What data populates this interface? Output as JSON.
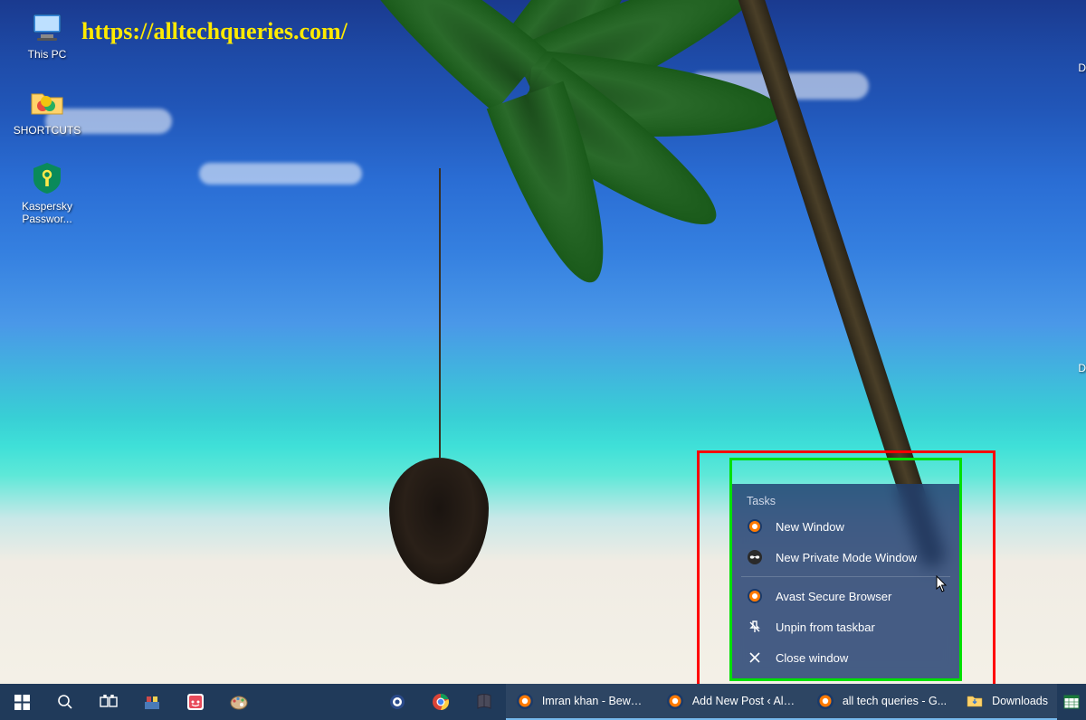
{
  "watermark_url": "https://alltechqueries.com/",
  "desktop_icons": {
    "thispc": {
      "label": "This PC"
    },
    "shortcuts": {
      "label": "SHORTCUTS"
    },
    "kaspersky": {
      "label": "Kaspersky Passwor..."
    }
  },
  "right_edge": {
    "label1": "D",
    "label2": "D"
  },
  "jumplist": {
    "section_header": "Tasks",
    "items": {
      "new_window": {
        "label": "New Window"
      },
      "new_private": {
        "label": "New Private Mode Window"
      },
      "app_name": {
        "label": "Avast Secure Browser"
      },
      "unpin": {
        "label": "Unpin from taskbar"
      },
      "close": {
        "label": "Close window"
      }
    }
  },
  "taskbar": {
    "apps": {
      "imran": {
        "label": "Imran khan - Bewaf..."
      },
      "addnew": {
        "label": "Add New Post ‹ All ..."
      },
      "alltech": {
        "label": "all tech queries - G..."
      },
      "downloads": {
        "label": "Downloads"
      }
    }
  }
}
